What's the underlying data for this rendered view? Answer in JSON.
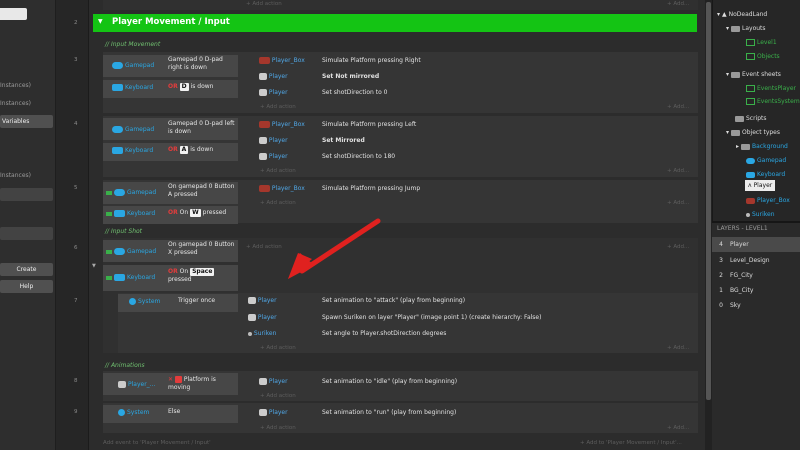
{
  "left_sidebar": {
    "items": [
      "Instances)",
      "Instances)",
      "Variables",
      "Instances)"
    ],
    "create_label": "Create",
    "help_label": "Help"
  },
  "event_numbers": [
    "2",
    "3",
    "4",
    "5",
    "6",
    "7",
    "8",
    "9"
  ],
  "group": {
    "title": "Player Movement / Input"
  },
  "comments": {
    "input_movement": "// Input Movement",
    "input_shot": "// Input Shot",
    "animations": "// Animations"
  },
  "add_action": "+ Add action",
  "add_short": "+ Add...",
  "add_event_footer": "Add event to 'Player Movement / Input'",
  "add_event_footer_right": "+ Add to 'Player Movement / Input'...",
  "objects": {
    "gamepad": "Gamepad",
    "keyboard": "Keyboard",
    "system": "System",
    "player_box": "Player_Box",
    "player": "Player",
    "suriken": "Suriken",
    "player_short": "Player_..."
  },
  "events": {
    "e3": {
      "cond1_text": "Gamepad 0 D-pad right is down",
      "cond2_or": "OR",
      "cond2_key": "D",
      "cond2_tail": "is down",
      "actions": [
        {
          "obj": "Player_Box",
          "text": "Simulate  Platform pressing Right"
        },
        {
          "obj": "Player",
          "text": "Set Not mirrored"
        },
        {
          "obj": "Player",
          "text": "Set shotDirection to 0"
        }
      ]
    },
    "e4": {
      "cond1_text": "Gamepad 0 D-pad left is down",
      "cond2_or": "OR",
      "cond2_key": "A",
      "cond2_tail": "is down",
      "actions": [
        {
          "obj": "Player_Box",
          "text": "Simulate  Platform pressing Left"
        },
        {
          "obj": "Player",
          "text": "Set Mirrored"
        },
        {
          "obj": "Player",
          "text": "Set shotDirection to 180"
        }
      ]
    },
    "e5": {
      "cond1_text": "On gamepad 0 Button A pressed",
      "cond2_or": "OR",
      "cond2_on": "On",
      "cond2_key": "W",
      "cond2_tail": "pressed",
      "actions": [
        {
          "obj": "Player_Box",
          "text": "Simulate  Platform pressing Jump"
        }
      ]
    },
    "e6": {
      "cond1_text": "On gamepad 0 Button X pressed",
      "cond2_or": "OR",
      "cond2_on": "On",
      "cond2_key": "Space",
      "cond2_tail": "pressed"
    },
    "e7": {
      "cond_text": "Trigger once",
      "actions": [
        {
          "obj": "Player",
          "text": "Set animation to \"attack\" (play from beginning)"
        },
        {
          "obj": "Player",
          "text": "Spawn  Suriken on layer \"Player\" (image point 1) (create hierarchy: False)"
        },
        {
          "obj": "Suriken",
          "text": "Set angle to Player.shotDirection degrees"
        }
      ]
    },
    "e8": {
      "cond_text": "Platform is moving",
      "actions": [
        {
          "obj": "Player",
          "text": "Set animation to \"idle\" (play from beginning)"
        }
      ]
    },
    "e9": {
      "cond_text": "Else",
      "actions": [
        {
          "obj": "Player",
          "text": "Set animation to \"run\" (play from beginning)"
        }
      ]
    }
  },
  "project_tree": {
    "root": "NoDeadLand",
    "layouts": "Layouts",
    "layout_items": [
      "Level1",
      "Objects"
    ],
    "event_sheets": "Event sheets",
    "event_items": [
      "EventsPlayer",
      "EventsSystem"
    ],
    "scripts": "Scripts",
    "object_types": "Object types",
    "object_items": [
      "Background",
      "Gamepad",
      "Keyboard",
      "Player",
      "Player_Box",
      "Suriken"
    ]
  },
  "layers_panel": {
    "title": "LAYERS - LEVEL1",
    "layers": [
      {
        "num": "4",
        "name": "Player"
      },
      {
        "num": "3",
        "name": "Level_Design"
      },
      {
        "num": "2",
        "name": "FG_City"
      },
      {
        "num": "1",
        "name": "BG_City"
      },
      {
        "num": "0",
        "name": "Sky"
      }
    ]
  },
  "colors": {
    "group_header": "#14c414",
    "arrow": "#e0211f",
    "object_blue": "#2aa7e3",
    "or_red": "#e23c3c"
  }
}
